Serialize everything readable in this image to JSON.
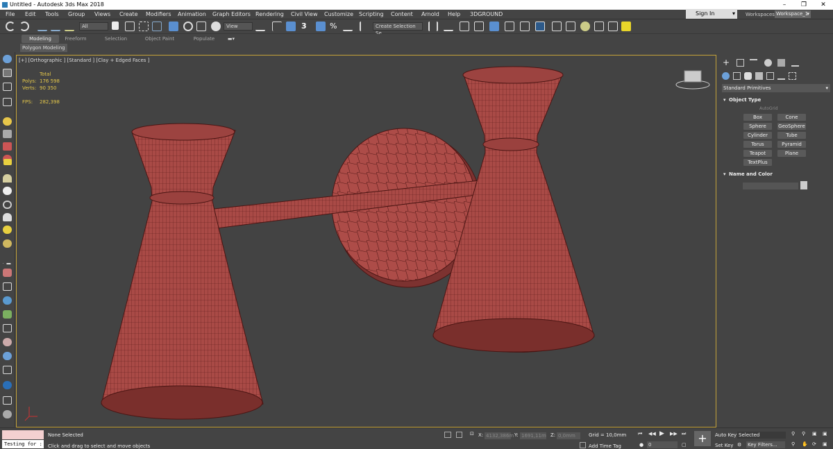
{
  "app": {
    "title": "Untitled - Autodesk 3ds Max 2018"
  },
  "menu": [
    "File",
    "Edit",
    "Tools",
    "Group",
    "Views",
    "Create",
    "Modifiers",
    "Animation",
    "Graph Editors",
    "Rendering",
    "Civil View",
    "Customize",
    "Scripting",
    "Content",
    "Arnold",
    "Help",
    "3DGROUND"
  ],
  "account": {
    "signin": "Sign In",
    "workspaces_label": "Workspaces:",
    "workspace": "Workspace_1"
  },
  "toolbar": {
    "filter": "All",
    "refcoord": "View",
    "selection_set": "Create Selection Se"
  },
  "ribbon": {
    "tabs": [
      "Modeling",
      "Freeform",
      "Selection",
      "Object Paint",
      "Populate"
    ],
    "subtab": "Polygon Modeling"
  },
  "viewport": {
    "label": "[+] [Orthographic ] [Standard ] [Clay + Edged Faces ]",
    "stats": {
      "total_label": "Total",
      "polys_label": "Polys:",
      "polys": "176 598",
      "verts_label": "Verts:",
      "verts": "90 350",
      "fps_label": "FPS:",
      "fps": "282,398"
    }
  },
  "command_panel": {
    "category": "Standard Primitives",
    "object_type": "Object Type",
    "autogrid": "AutoGrid",
    "buttons": [
      "Box",
      "Cone",
      "Sphere",
      "GeoSphere",
      "Cylinder",
      "Tube",
      "Torus",
      "Pyramid",
      "Teapot",
      "Plane",
      "TextPlus"
    ],
    "name_color": "Name and Color"
  },
  "status": {
    "selected": "None Selected",
    "prompt": "Click and drag to select and move objects",
    "testing": "Testing for :",
    "x_label": "X:",
    "x": "4132,386m",
    "y_label": "Y:",
    "y": "1691,11m",
    "z_label": "Z:",
    "z": "0,0mm",
    "grid": "Grid = 10,0mm",
    "add_time_tag": "Add Time Tag",
    "auto_key": "Auto Key",
    "set_key": "Set Key",
    "selected_dd": "Selected",
    "key_filters": "Key Filters...",
    "frame": "0"
  },
  "colors": {
    "mesh": "#a94a46",
    "wire": "#5a1c1a",
    "viewport_bg": "#434343",
    "active_border": "#c5a33a",
    "stats": "#e5c84a"
  }
}
